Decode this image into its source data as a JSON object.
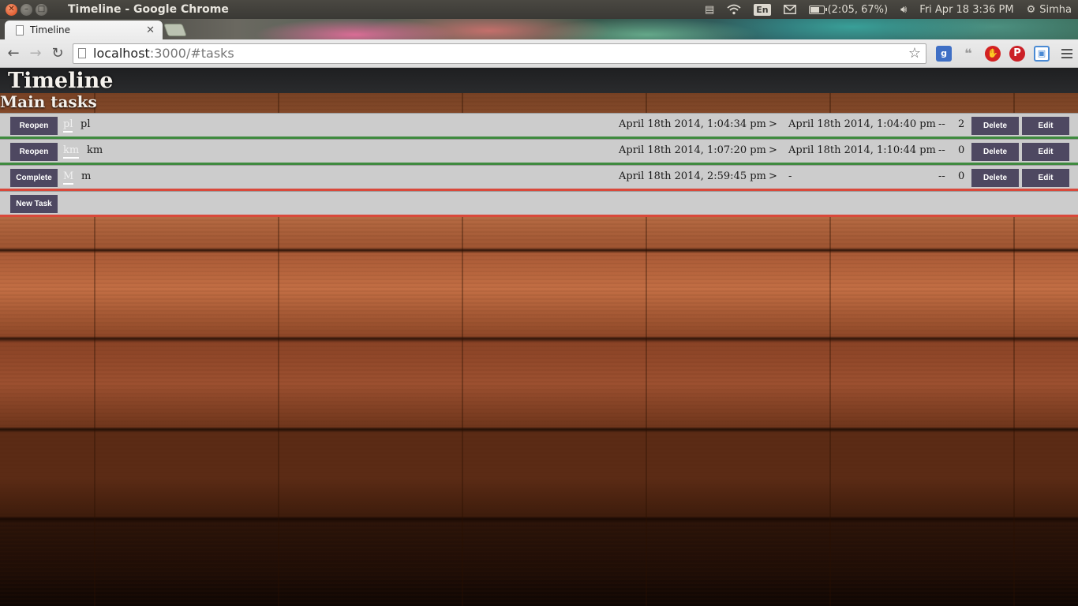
{
  "os": {
    "window_title": "Timeline - Google Chrome",
    "keyboard": "En",
    "battery": "(2:05, 67%)",
    "battery_level": 0.67,
    "clock": "Fri Apr 18  3:36 PM",
    "user": "Simha"
  },
  "browser": {
    "tab_title": "Timeline",
    "url_host": "localhost",
    "url_rest": ":3000/#tasks"
  },
  "app": {
    "title": "Timeline",
    "section_title": "Main tasks",
    "new_task_label": "New Task",
    "delete_label": "Delete",
    "edit_label": "Edit",
    "arrow": ">",
    "separator": "--"
  },
  "tasks": [
    {
      "action": "Reopen",
      "short": "pl",
      "name": "pl",
      "start": "April 18th 2014, 1:04:34 pm",
      "end": "April 18th 2014, 1:04:40 pm",
      "count": "2",
      "status": "done",
      "status_color": "#3f8a3f"
    },
    {
      "action": "Reopen",
      "short": "km",
      "name": "km",
      "start": "April 18th 2014, 1:07:20 pm",
      "end": "April 18th 2014, 1:10:44 pm",
      "count": "0",
      "status": "done",
      "status_color": "#3f8a3f"
    },
    {
      "action": "Complete",
      "short": "M",
      "name": "m",
      "start": "April 18th 2014, 2:59:45 pm",
      "end": "-",
      "count": "0",
      "status": "pending",
      "status_color": "#d9483a"
    }
  ],
  "colors": {
    "button_bg": "#4e4861",
    "row_bg": "#cccccc",
    "header_bg": "#1e1f21"
  },
  "icons": {
    "back": "arrow-left-icon",
    "forward": "arrow-right-icon",
    "reload": "reload-icon",
    "bookmark": "star-icon",
    "menu": "hamburger-icon"
  }
}
